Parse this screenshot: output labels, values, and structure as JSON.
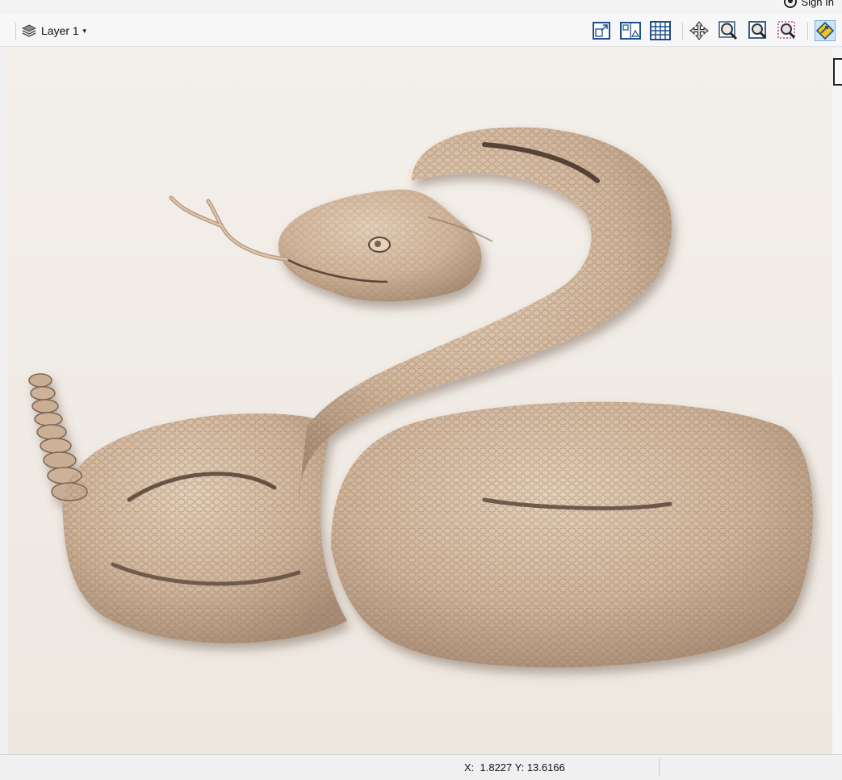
{
  "header": {
    "signin_label": "Sign In"
  },
  "toolbar": {
    "layer_label": "Layer 1",
    "tools": [
      {
        "icon": "view-resize-icon"
      },
      {
        "icon": "vector-view-icon"
      },
      {
        "icon": "grid-icon"
      },
      {
        "icon": "pan-icon"
      },
      {
        "icon": "zoom-extents-icon"
      },
      {
        "icon": "zoom-selection-icon"
      },
      {
        "icon": "zoom-region-icon"
      },
      {
        "icon": "snap-icon",
        "active": true
      }
    ]
  },
  "canvas": {
    "content": "rattlesnake-relief-model",
    "background_color": "#f1ece6",
    "model_color": "#d2b9a0"
  },
  "status": {
    "coords": "X:  1.8227 Y: 13.6166"
  }
}
